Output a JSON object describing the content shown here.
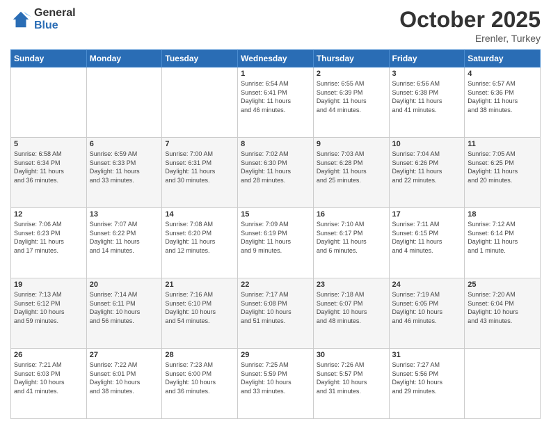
{
  "logo": {
    "general": "General",
    "blue": "Blue"
  },
  "header": {
    "month": "October 2025",
    "location": "Erenler, Turkey"
  },
  "days_of_week": [
    "Sunday",
    "Monday",
    "Tuesday",
    "Wednesday",
    "Thursday",
    "Friday",
    "Saturday"
  ],
  "weeks": [
    [
      {
        "day": "",
        "info": ""
      },
      {
        "day": "",
        "info": ""
      },
      {
        "day": "",
        "info": ""
      },
      {
        "day": "1",
        "info": "Sunrise: 6:54 AM\nSunset: 6:41 PM\nDaylight: 11 hours\nand 46 minutes."
      },
      {
        "day": "2",
        "info": "Sunrise: 6:55 AM\nSunset: 6:39 PM\nDaylight: 11 hours\nand 44 minutes."
      },
      {
        "day": "3",
        "info": "Sunrise: 6:56 AM\nSunset: 6:38 PM\nDaylight: 11 hours\nand 41 minutes."
      },
      {
        "day": "4",
        "info": "Sunrise: 6:57 AM\nSunset: 6:36 PM\nDaylight: 11 hours\nand 38 minutes."
      }
    ],
    [
      {
        "day": "5",
        "info": "Sunrise: 6:58 AM\nSunset: 6:34 PM\nDaylight: 11 hours\nand 36 minutes."
      },
      {
        "day": "6",
        "info": "Sunrise: 6:59 AM\nSunset: 6:33 PM\nDaylight: 11 hours\nand 33 minutes."
      },
      {
        "day": "7",
        "info": "Sunrise: 7:00 AM\nSunset: 6:31 PM\nDaylight: 11 hours\nand 30 minutes."
      },
      {
        "day": "8",
        "info": "Sunrise: 7:02 AM\nSunset: 6:30 PM\nDaylight: 11 hours\nand 28 minutes."
      },
      {
        "day": "9",
        "info": "Sunrise: 7:03 AM\nSunset: 6:28 PM\nDaylight: 11 hours\nand 25 minutes."
      },
      {
        "day": "10",
        "info": "Sunrise: 7:04 AM\nSunset: 6:26 PM\nDaylight: 11 hours\nand 22 minutes."
      },
      {
        "day": "11",
        "info": "Sunrise: 7:05 AM\nSunset: 6:25 PM\nDaylight: 11 hours\nand 20 minutes."
      }
    ],
    [
      {
        "day": "12",
        "info": "Sunrise: 7:06 AM\nSunset: 6:23 PM\nDaylight: 11 hours\nand 17 minutes."
      },
      {
        "day": "13",
        "info": "Sunrise: 7:07 AM\nSunset: 6:22 PM\nDaylight: 11 hours\nand 14 minutes."
      },
      {
        "day": "14",
        "info": "Sunrise: 7:08 AM\nSunset: 6:20 PM\nDaylight: 11 hours\nand 12 minutes."
      },
      {
        "day": "15",
        "info": "Sunrise: 7:09 AM\nSunset: 6:19 PM\nDaylight: 11 hours\nand 9 minutes."
      },
      {
        "day": "16",
        "info": "Sunrise: 7:10 AM\nSunset: 6:17 PM\nDaylight: 11 hours\nand 6 minutes."
      },
      {
        "day": "17",
        "info": "Sunrise: 7:11 AM\nSunset: 6:15 PM\nDaylight: 11 hours\nand 4 minutes."
      },
      {
        "day": "18",
        "info": "Sunrise: 7:12 AM\nSunset: 6:14 PM\nDaylight: 11 hours\nand 1 minute."
      }
    ],
    [
      {
        "day": "19",
        "info": "Sunrise: 7:13 AM\nSunset: 6:12 PM\nDaylight: 10 hours\nand 59 minutes."
      },
      {
        "day": "20",
        "info": "Sunrise: 7:14 AM\nSunset: 6:11 PM\nDaylight: 10 hours\nand 56 minutes."
      },
      {
        "day": "21",
        "info": "Sunrise: 7:16 AM\nSunset: 6:10 PM\nDaylight: 10 hours\nand 54 minutes."
      },
      {
        "day": "22",
        "info": "Sunrise: 7:17 AM\nSunset: 6:08 PM\nDaylight: 10 hours\nand 51 minutes."
      },
      {
        "day": "23",
        "info": "Sunrise: 7:18 AM\nSunset: 6:07 PM\nDaylight: 10 hours\nand 48 minutes."
      },
      {
        "day": "24",
        "info": "Sunrise: 7:19 AM\nSunset: 6:05 PM\nDaylight: 10 hours\nand 46 minutes."
      },
      {
        "day": "25",
        "info": "Sunrise: 7:20 AM\nSunset: 6:04 PM\nDaylight: 10 hours\nand 43 minutes."
      }
    ],
    [
      {
        "day": "26",
        "info": "Sunrise: 7:21 AM\nSunset: 6:03 PM\nDaylight: 10 hours\nand 41 minutes."
      },
      {
        "day": "27",
        "info": "Sunrise: 7:22 AM\nSunset: 6:01 PM\nDaylight: 10 hours\nand 38 minutes."
      },
      {
        "day": "28",
        "info": "Sunrise: 7:23 AM\nSunset: 6:00 PM\nDaylight: 10 hours\nand 36 minutes."
      },
      {
        "day": "29",
        "info": "Sunrise: 7:25 AM\nSunset: 5:59 PM\nDaylight: 10 hours\nand 33 minutes."
      },
      {
        "day": "30",
        "info": "Sunrise: 7:26 AM\nSunset: 5:57 PM\nDaylight: 10 hours\nand 31 minutes."
      },
      {
        "day": "31",
        "info": "Sunrise: 7:27 AM\nSunset: 5:56 PM\nDaylight: 10 hours\nand 29 minutes."
      },
      {
        "day": "",
        "info": ""
      }
    ]
  ]
}
